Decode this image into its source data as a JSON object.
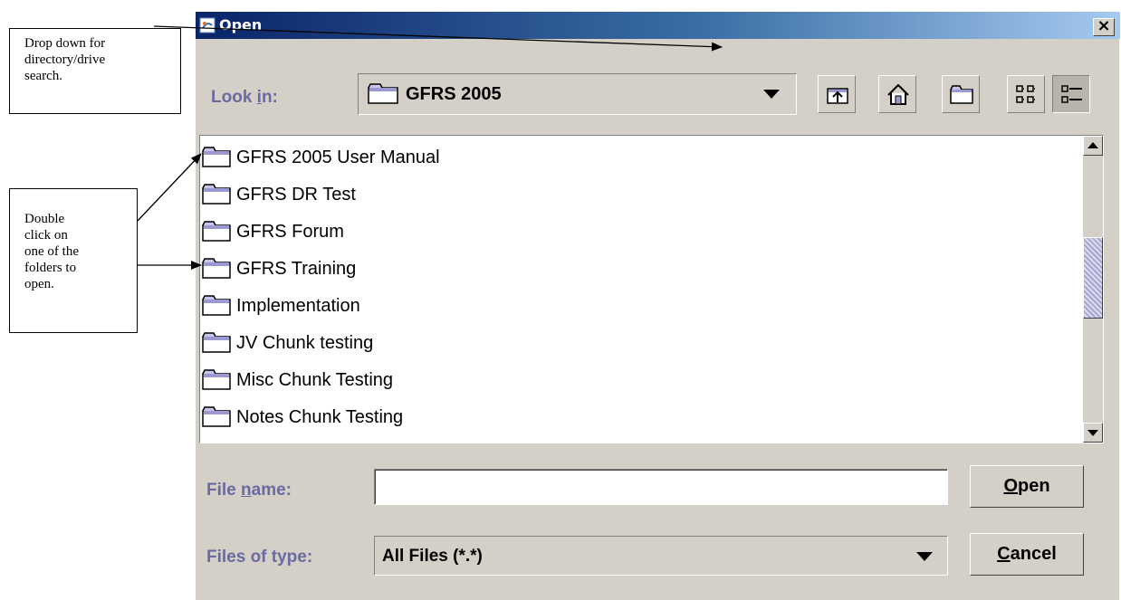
{
  "annotations": {
    "callout_1_lines": [
      "Drop down  for",
      "directory/drive",
      "search."
    ],
    "callout_2_lines": [
      "Double",
      "click on",
      "one of the",
      "folders to",
      "open."
    ]
  },
  "dialog": {
    "title": "Open",
    "close_glyph": "×",
    "look_in": {
      "label_pre": "Look ",
      "label_mnemonic": "i",
      "label_post": "n:",
      "value": "GFRS 2005"
    },
    "toolbar": [
      "up-one-level-icon",
      "home-icon",
      "new-folder-icon",
      "list-view-icon",
      "details-view-icon"
    ],
    "files": [
      "GFRS 2005 User Manual",
      "GFRS DR Test",
      "GFRS Forum",
      "GFRS Training",
      "Implementation",
      "JV Chunk testing",
      "Misc Chunk Testing",
      "Notes Chunk Testing"
    ],
    "file_name": {
      "label_pre": "File ",
      "label_mnemonic": "n",
      "label_post": "ame:",
      "value": ""
    },
    "files_of_type": {
      "label": "Files of type:",
      "value": "All Files (*.*)"
    },
    "open_button": {
      "mnemonic": "O",
      "rest": "pen"
    },
    "cancel_button": {
      "mnemonic": "C",
      "rest": "ancel"
    }
  },
  "colors": {
    "title_gradient_start": "#0a246a",
    "title_gradient_end": "#a6caf0",
    "label_color": "#6a6aa0",
    "dialog_bg": "#d4d0c8",
    "scroll_thumb": "#c4c0e0"
  }
}
